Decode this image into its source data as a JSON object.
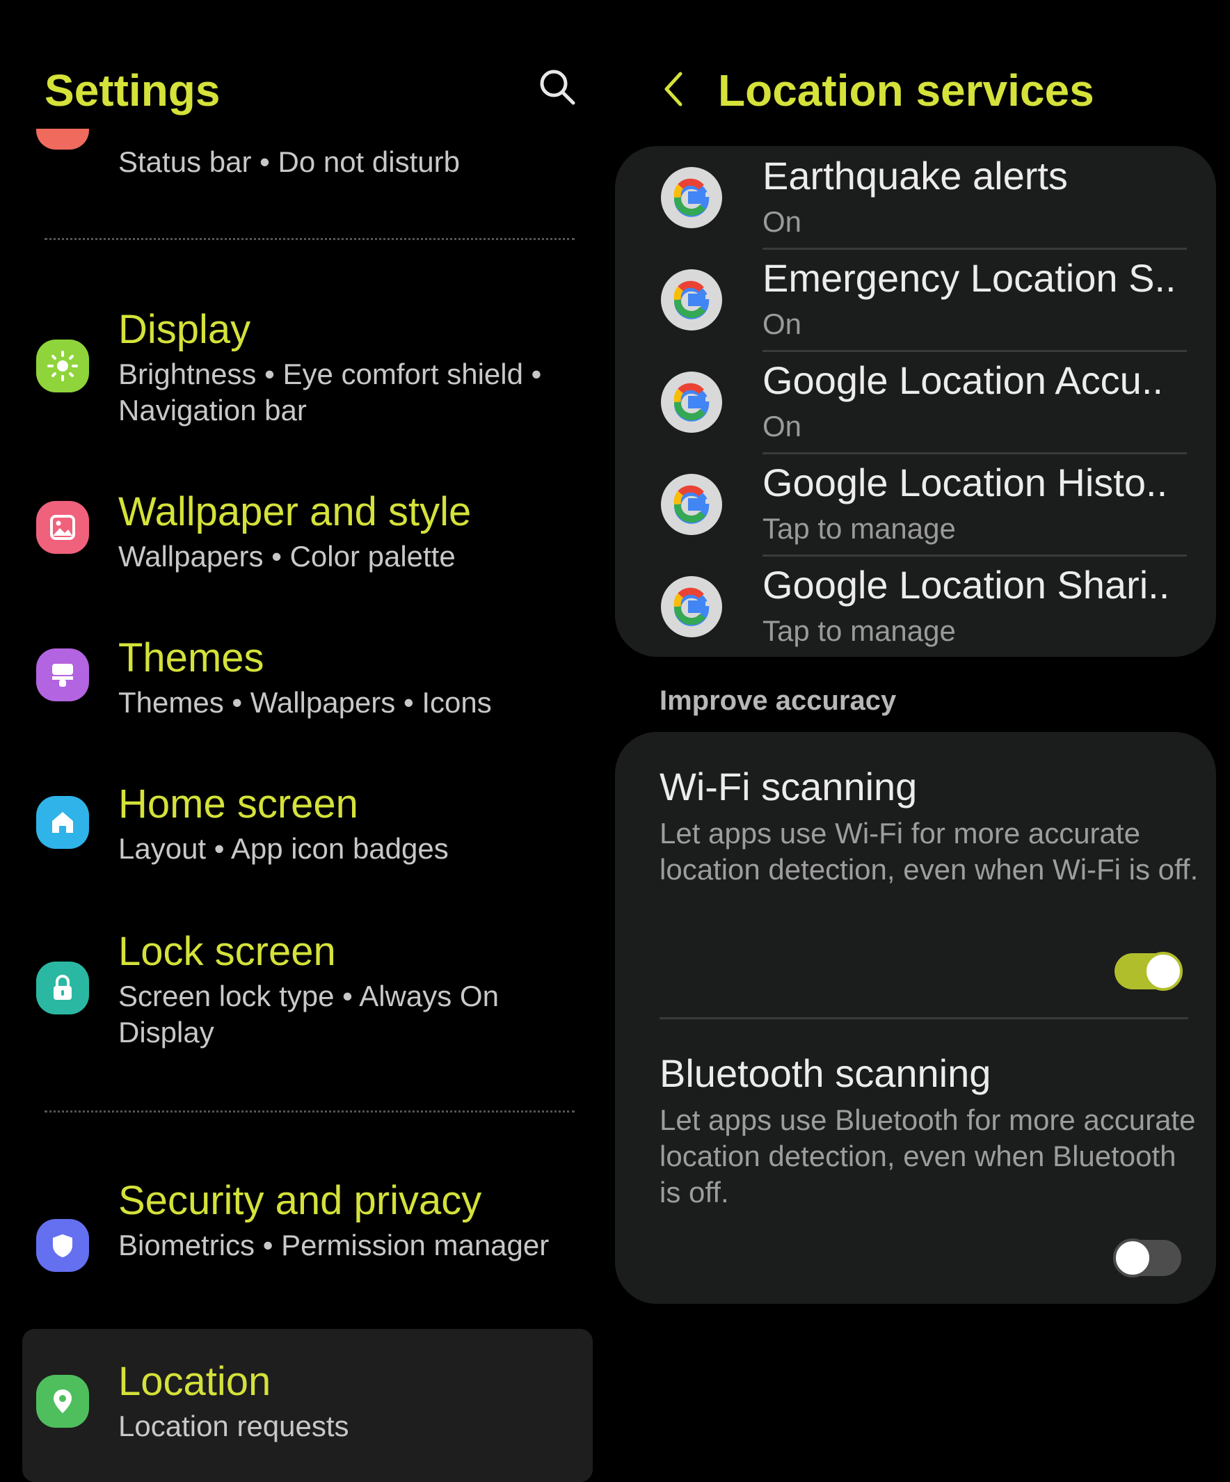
{
  "settings": {
    "title": "Settings",
    "partial_item": {
      "sub": "Status bar  •  Do not disturb",
      "icon": "notifications-icon"
    },
    "items": [
      {
        "title": "Display",
        "sub": "Brightness  •  Eye comfort shield  •  Navigation bar",
        "icon": "sun-icon",
        "color": "#8fd43b"
      },
      {
        "title": "Wallpaper and style",
        "sub": "Wallpapers  •  Color palette",
        "icon": "picture-icon",
        "color": "#f0617c"
      },
      {
        "title": "Themes",
        "sub": "Themes  •  Wallpapers  •  Icons",
        "icon": "brush-icon",
        "color": "#b364e0"
      },
      {
        "title": "Home screen",
        "sub": "Layout  •  App icon badges",
        "icon": "house-icon",
        "color": "#2fb3e8"
      },
      {
        "title": "Lock screen",
        "sub": "Screen lock type  •  Always On Display",
        "icon": "padlock-icon",
        "color": "#2bb8a3"
      },
      {
        "title": "Security and privacy",
        "sub": "Biometrics  •  Permission manager",
        "icon": "shield-icon",
        "color": "#6470f0"
      },
      {
        "title": "Location",
        "sub": "Location requests",
        "icon": "location-pin-icon",
        "color": "#4fbf5e"
      }
    ]
  },
  "location_services": {
    "title": "Location services",
    "apps": [
      {
        "name": "Earthquake alerts",
        "status": "On"
      },
      {
        "name": "Emergency Location S..",
        "status": "On"
      },
      {
        "name": "Google Location Accu..",
        "status": "On"
      },
      {
        "name": "Google Location Histo..",
        "status": "Tap to manage"
      },
      {
        "name": "Google Location Shari..",
        "status": "Tap to manage"
      }
    ],
    "section_label": "Improve accuracy",
    "wifi_scanning": {
      "title": "Wi-Fi scanning",
      "desc": "Let apps use Wi-Fi for more accurate location detection, even when Wi-Fi is off.",
      "enabled": true
    },
    "bluetooth_scanning": {
      "title": "Bluetooth scanning",
      "desc": "Let apps use Bluetooth for more accurate location detection, even when Bluetooth is off.",
      "enabled": false
    }
  },
  "colors": {
    "accent": "#d4e23a",
    "toggle_on": "#b1be2c",
    "card_bg": "#1b1c1c"
  }
}
